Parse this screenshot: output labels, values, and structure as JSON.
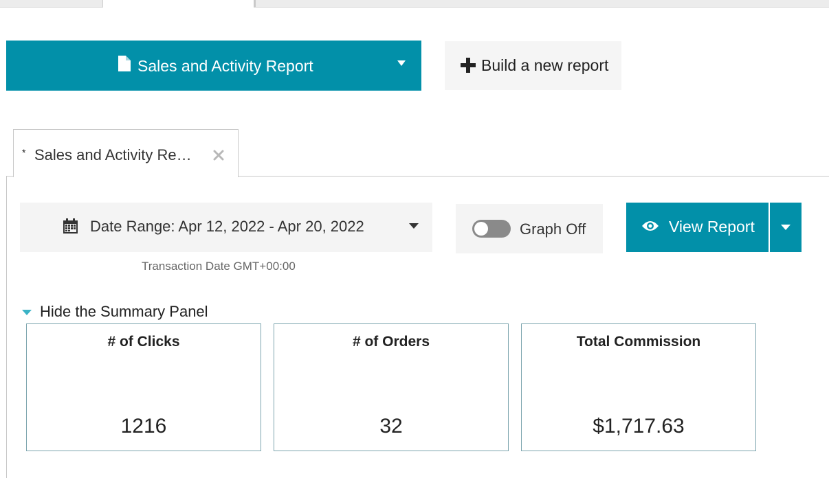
{
  "report_selector": {
    "label": "Sales and Activity Report",
    "icon": "document-icon"
  },
  "build_button": {
    "label": "Build a new report",
    "icon": "plus-icon"
  },
  "report_tab": {
    "modified_marker": "*",
    "label": "Sales and Activity Re…",
    "close_icon": "close-icon"
  },
  "date_range": {
    "label": "Date Range: Apr 12, 2022 - Apr 20, 2022",
    "icon": "calendar-icon",
    "note": "Transaction Date GMT+00:00"
  },
  "graph": {
    "label": "Graph Off",
    "enabled": false
  },
  "view_report": {
    "label": "View Report",
    "icon": "eye-icon"
  },
  "summary_panel": {
    "toggle_label": "Hide the Summary Panel",
    "cards": [
      {
        "title": "# of Clicks",
        "value": "1216"
      },
      {
        "title": "# of Orders",
        "value": "32"
      },
      {
        "title": "Total Commission",
        "value": "$1,717.63"
      }
    ]
  },
  "colors": {
    "accent": "#0290a9",
    "button_bg": "#f4f4f4",
    "card_border": "#7aa3ad"
  }
}
